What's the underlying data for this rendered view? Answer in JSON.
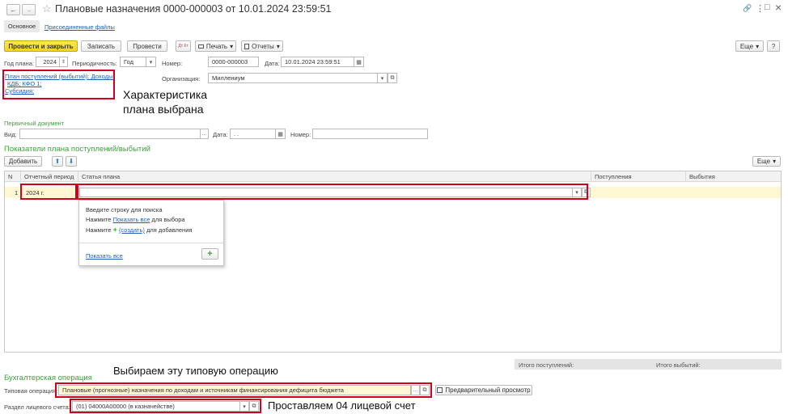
{
  "window": {
    "back_glyph": "←",
    "forward_glyph": "→",
    "star_glyph": "☆",
    "title": "Плановые назначения 0000-000003 от 10.01.2024 23:59:51",
    "link_glyph": "🔗",
    "menu_glyph": "⋮",
    "minimize_glyph": "□",
    "close_glyph": "×"
  },
  "tabs": {
    "main": "Основное",
    "attached": "Присоединенные файлы"
  },
  "toolbar": {
    "post_close": "Провести и закрыть",
    "save": "Записать",
    "post": "Провести",
    "dt_kt": "Дт Кт",
    "print": "Печать",
    "reports": "Отчеты",
    "more": "Еще"
  },
  "header": {
    "year_label": "Год плана:",
    "year_value": "2024",
    "periodicity_label": "Периодичность:",
    "periodicity_value": "Год",
    "number_label": "Номер:",
    "number_value": "0000-000003",
    "date_label": "Дата:",
    "date_value": "10.01.2024 23:59:51",
    "organization_label": "Организация:",
    "organization_value": "Миллениум",
    "plan_link_1": "План поступлений (выбытий): Доходы;",
    "plan_link_2": "КДБ; КФО 1;",
    "plan_link_3": "Субсидия;"
  },
  "primary_doc": {
    "section_title": "Первичный документ",
    "kind_label": "Вид:",
    "kind_value": "",
    "date_label": "Дата:",
    "date_value": ". .",
    "number_label": "Номер:",
    "number_value": ""
  },
  "indicators": {
    "section_title": "Показатели плана поступлений/выбытий",
    "add_button": "Добавить",
    "up_glyph": "⬆",
    "down_glyph": "⬇",
    "more": "Еще",
    "columns": [
      "N",
      "Отчетный период",
      "Статья плана",
      "Поступления",
      "Выбытия"
    ],
    "rows": [
      {
        "n": "1",
        "period": "2024 г.",
        "article": "",
        "income": "",
        "expense": ""
      }
    ],
    "total_income_label": "Итого поступлений:",
    "total_expense_label": "Итого выбытий:"
  },
  "dropdown": {
    "line1": "Введите строку для поиска",
    "line2_pre": "Нажмите",
    "line2_link": "Показать все",
    "line2_post": "для выбора",
    "line3_pre": "Нажмите",
    "line3_link": "(создать)",
    "line3_post": "для добавления",
    "show_all": "Показать все",
    "plus_glyph": "+"
  },
  "accounting": {
    "section_title": "Бухгалтерская операция",
    "typical_op_label": "Типовая операция:",
    "typical_op_value": "Плановые (прогнозные) назначения по доходам и источникам финансирования дефицита бюджета",
    "preview_button": "Предварительный просмотр",
    "account_section_label": "Раздел лицевого счета:",
    "account_section_value": "(01) 04000А00000 (в казначействе)"
  },
  "annotations": {
    "characteristic_1": "Характеристика",
    "characteristic_2": "плана выбрана",
    "choose_operation": "Выбираем эту типовую операцию",
    "set_account": "Проставляем 04 лицевой счет"
  },
  "glyphs": {
    "ellipsis": "...",
    "dropdown": "▾",
    "open_link": "⧉",
    "calendar": "▦",
    "spin": "⇕"
  },
  "colors": {
    "primary_button": "#f2d324",
    "highlight_border": "#d0021b",
    "section_green": "#3aa13a",
    "link_blue": "#1f5eb8",
    "selected_row": "#fff6d4"
  }
}
